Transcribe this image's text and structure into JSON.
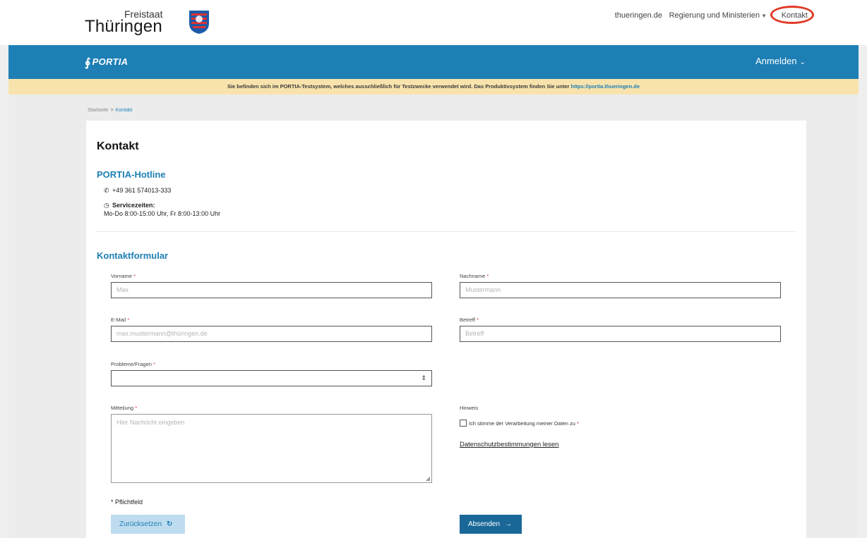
{
  "topbar": {
    "logo_small": "Freistaat",
    "logo_big": "Thüringen",
    "nav": [
      "thueringen.de",
      "Regierung und Ministerien",
      "Kontakt"
    ]
  },
  "header": {
    "brand": "PORTIA",
    "login_label": "Anmelden"
  },
  "notice": {
    "text": "Sie befinden sich im PORTIA-Testsystem, welches ausschließlich für Testzwecke verwendet wird. Das Produktivsystem finden Sie unter",
    "link": "https://portia.thueringen.de"
  },
  "breadcrumb": {
    "home": "Startseite",
    "current": "Kontakt"
  },
  "page": {
    "title": "Kontakt",
    "hotline_title": "PORTIA-Hotline",
    "phone": "+49 361 574013-333",
    "service_label": "Servicezeiten:",
    "service_hours": "Mo-Do 8:00-15:00 Uhr, Fr 8:00-13:00 Uhr",
    "form_title": "Kontaktformular"
  },
  "form": {
    "vorname_label": "Vorname",
    "vorname_placeholder": "Max",
    "nachname_label": "Nachname",
    "nachname_placeholder": "Mustermann",
    "email_label": "E-Mail",
    "email_placeholder": "max.mustermann@thüringen.de",
    "betreff_label": "Betreff",
    "betreff_placeholder": "Betreff",
    "probleme_label": "Probleme/Fragen",
    "probleme_value": "",
    "mitteilung_label": "Mitteilung",
    "mitteilung_placeholder": "Hier Nachricht eingeben",
    "hinweis_label": "Hinweis",
    "consent_label": "Ich stimme der Verarbeitung meiner Daten zu",
    "privacy_link": "Datenschutzbestimmungen lesen",
    "required_note": "* Pflichtfeld",
    "reset_label": "Zurücksetzen",
    "send_label": "Absenden",
    "required_mark": "*"
  },
  "colors": {
    "primary": "#1e7fb5",
    "notice_bg": "#f8e3ad",
    "highlight_ring": "#e03a25"
  },
  "icons": [
    "phone-icon",
    "clock-icon",
    "refresh-icon",
    "arrow-right-icon",
    "chevron-down-icon",
    "select-arrows-icon"
  ]
}
